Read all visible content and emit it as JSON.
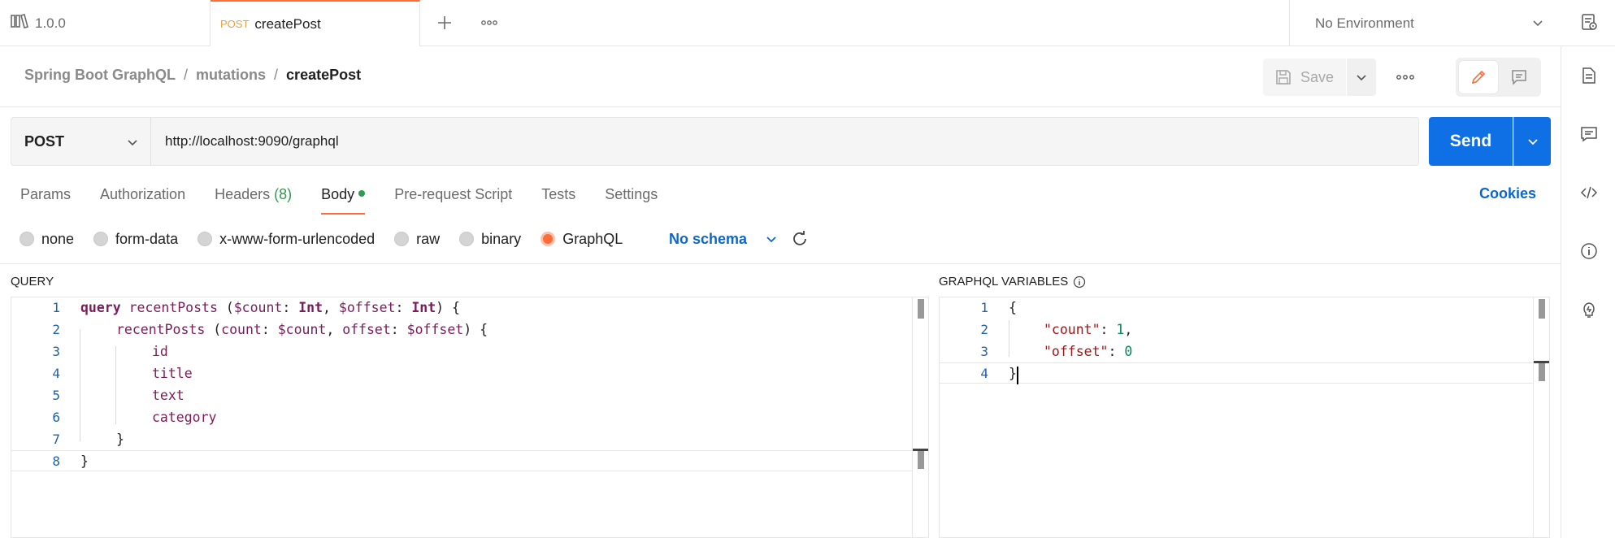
{
  "top_tabs": {
    "version_label": "1.0.0",
    "request_method": "POST",
    "request_name": "createPost",
    "add_label": "+",
    "more_label": "•••"
  },
  "environment": {
    "selected": "No Environment"
  },
  "breadcrumb": {
    "items": [
      "Spring Boot GraphQL",
      "mutations",
      "createPost"
    ],
    "separator": "/"
  },
  "actions": {
    "save_label": "Save",
    "more_label": "•••"
  },
  "request": {
    "method": "POST",
    "url": "http://localhost:9090/graphql",
    "send_label": "Send"
  },
  "request_tabs": {
    "params": "Params",
    "authorization": "Authorization",
    "headers": "Headers",
    "headers_count": "(8)",
    "body": "Body",
    "prerequest": "Pre-request Script",
    "tests": "Tests",
    "settings": "Settings",
    "active": "Body",
    "cookies": "Cookies"
  },
  "body_types": {
    "none": "none",
    "form_data": "form-data",
    "urlencoded": "x-www-form-urlencoded",
    "raw": "raw",
    "binary": "binary",
    "graphql": "GraphQL",
    "selected": "GraphQL",
    "schema": "No schema"
  },
  "query_panel": {
    "title": "QUERY",
    "line_numbers": [
      "1",
      "2",
      "3",
      "4",
      "5",
      "6",
      "7",
      "8"
    ],
    "lines": {
      "l1_kw": "query",
      "l1_name": " recentPosts ",
      "l1_rest_a": "(",
      "l1_var1": "$count",
      "l1_colon1": ": ",
      "l1_type1": "Int",
      "l1_comma": ", ",
      "l1_var2": "$offset",
      "l1_colon2": ": ",
      "l1_type2": "Int",
      "l1_close": ") {",
      "l2_name": "recentPosts",
      "l2_open": " (",
      "l2_arg1": "count",
      "l2_c1": ": ",
      "l2_v1": "$count",
      "l2_sep": ", ",
      "l2_arg2": "offset",
      "l2_c2": ": ",
      "l2_v2": "$offset",
      "l2_close": ") {",
      "l3": "id",
      "l4": "title",
      "l5": "text",
      "l6": "category",
      "l7": "}",
      "l8": "}"
    }
  },
  "vars_panel": {
    "title": "GRAPHQL VARIABLES",
    "line_numbers": [
      "1",
      "2",
      "3",
      "4"
    ],
    "lines": {
      "l1": "{",
      "l2_key": "\"count\"",
      "l2_colon": ": ",
      "l2_val": "1",
      "l2_comma": ",",
      "l3_key": "\"offset\"",
      "l3_colon": ": ",
      "l3_val": "0",
      "l4": "}"
    }
  },
  "colors": {
    "accent": "#ff6c37",
    "send": "#0f70e6",
    "link": "#0b66cf",
    "count_green": "#2e9b4f",
    "method_tab": "#e6a23c"
  },
  "icons": {
    "version": "collection-icon",
    "env_chevron": "chevron-down-icon",
    "rail": [
      "environment-quicklook-icon",
      "documentation-icon",
      "comments-icon",
      "code-icon",
      "info-icon",
      "lightbulb-icon"
    ]
  }
}
